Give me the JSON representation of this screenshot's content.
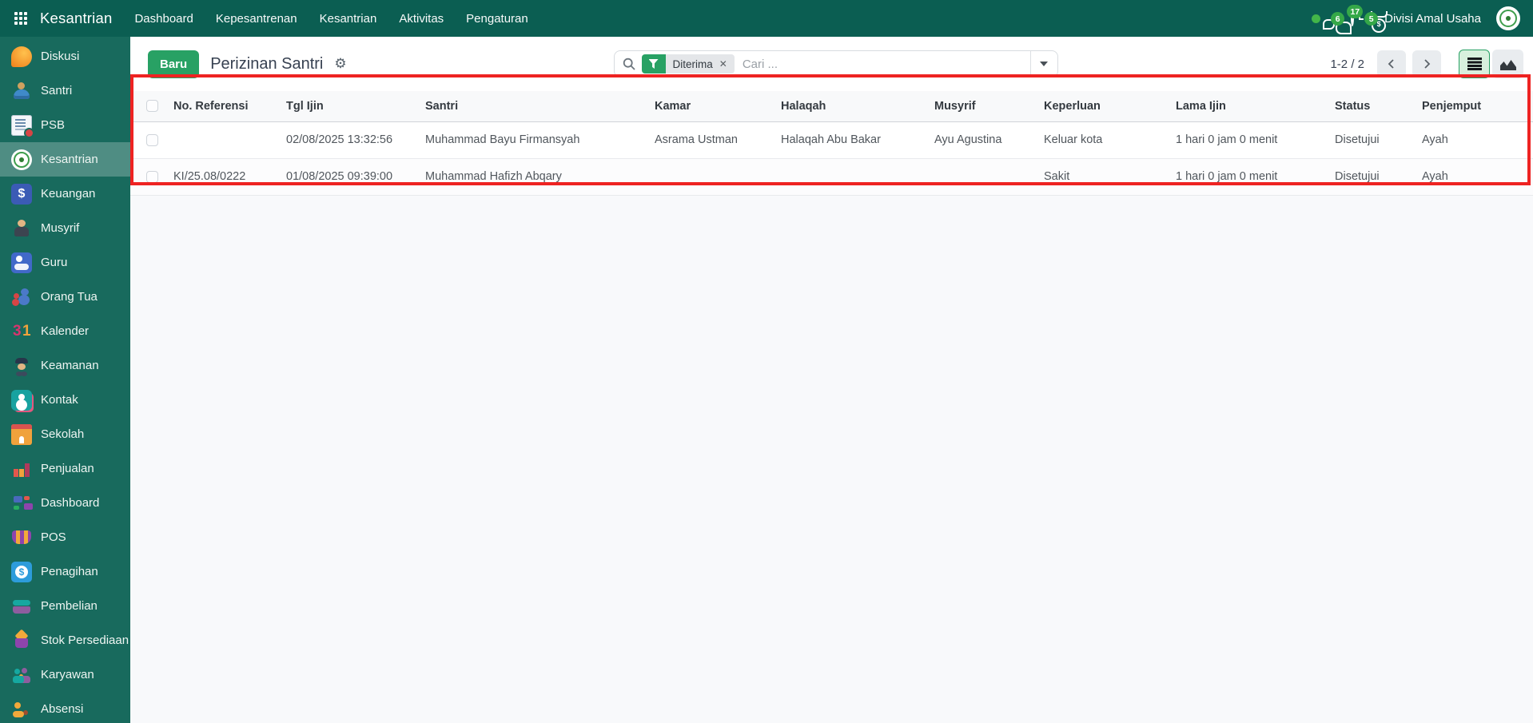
{
  "navbar": {
    "brand": "Kesantrian",
    "menus": [
      "Dashboard",
      "Kepesantrenan",
      "Kesantrian",
      "Aktivitas",
      "Pengaturan"
    ],
    "message_count": "6",
    "activity_count": "17",
    "money_count": "5",
    "company": "Divisi Amal Usaha"
  },
  "sidebar": {
    "items": [
      {
        "label": "Diskusi",
        "icon": "i-diskusi",
        "active": false
      },
      {
        "label": "Santri",
        "icon": "i-santri",
        "active": false
      },
      {
        "label": "PSB",
        "icon": "i-psb",
        "active": false
      },
      {
        "label": "Kesantrian",
        "icon": "i-kesantrian",
        "active": true
      },
      {
        "label": "Keuangan",
        "icon": "i-keuangan",
        "active": false
      },
      {
        "label": "Musyrif",
        "icon": "i-musyrif",
        "active": false
      },
      {
        "label": "Guru",
        "icon": "i-guru",
        "active": false
      },
      {
        "label": "Orang Tua",
        "icon": "i-orang-tua",
        "active": false
      },
      {
        "label": "Kalender",
        "icon": "i-kalender",
        "active": false
      },
      {
        "label": "Keamanan",
        "icon": "i-keamanan",
        "active": false
      },
      {
        "label": "Kontak",
        "icon": "i-kontak",
        "active": false
      },
      {
        "label": "Sekolah",
        "icon": "i-sekolah",
        "active": false
      },
      {
        "label": "Penjualan",
        "icon": "i-penjualan",
        "active": false
      },
      {
        "label": "Dashboard",
        "icon": "i-dashboard",
        "active": false
      },
      {
        "label": "POS",
        "icon": "i-pos",
        "active": false
      },
      {
        "label": "Penagihan",
        "icon": "i-penagihan",
        "active": false
      },
      {
        "label": "Pembelian",
        "icon": "i-pembelian",
        "active": false
      },
      {
        "label": "Stok Persediaan",
        "icon": "i-stok-persediaan",
        "active": false
      },
      {
        "label": "Karyawan",
        "icon": "i-karyawan",
        "active": false
      },
      {
        "label": "Absensi",
        "icon": "i-absensi",
        "active": false
      }
    ]
  },
  "control_panel": {
    "new_button_label": "Baru",
    "title": "Perizinan Santri",
    "search_placeholder": "Cari ...",
    "filter_facet": "Diterima",
    "pager_range": "1-2 / 2"
  },
  "table": {
    "columns": [
      "No. Referensi",
      "Tgl Ijin",
      "Santri",
      "Kamar",
      "Halaqah",
      "Musyrif",
      "Keperluan",
      "Lama Ijin",
      "Status",
      "Penjemput"
    ],
    "rows": [
      [
        "",
        "02/08/2025 13:32:56",
        "Muhammad Bayu Firmansyah",
        "Asrama Ustman",
        "Halaqah Abu Bakar",
        "Ayu Agustina",
        "Keluar kota",
        "1 hari 0 jam 0 menit",
        "Disetujui",
        "Ayah"
      ],
      [
        "KI/25.08/0222",
        "01/08/2025 09:39:00",
        "Muhammad Hafizh Abqary",
        "",
        "",
        "",
        "Sakit",
        "1 hari 0 jam 0 menit",
        "Disetujui",
        "Ayah"
      ]
    ]
  },
  "colors": {
    "navbar_teal": "#0b5e52",
    "sidebar_teal": "#186a5d",
    "accent_green": "#28a164",
    "badge_green": "#35a848",
    "annotation_red": "#ee2322"
  }
}
